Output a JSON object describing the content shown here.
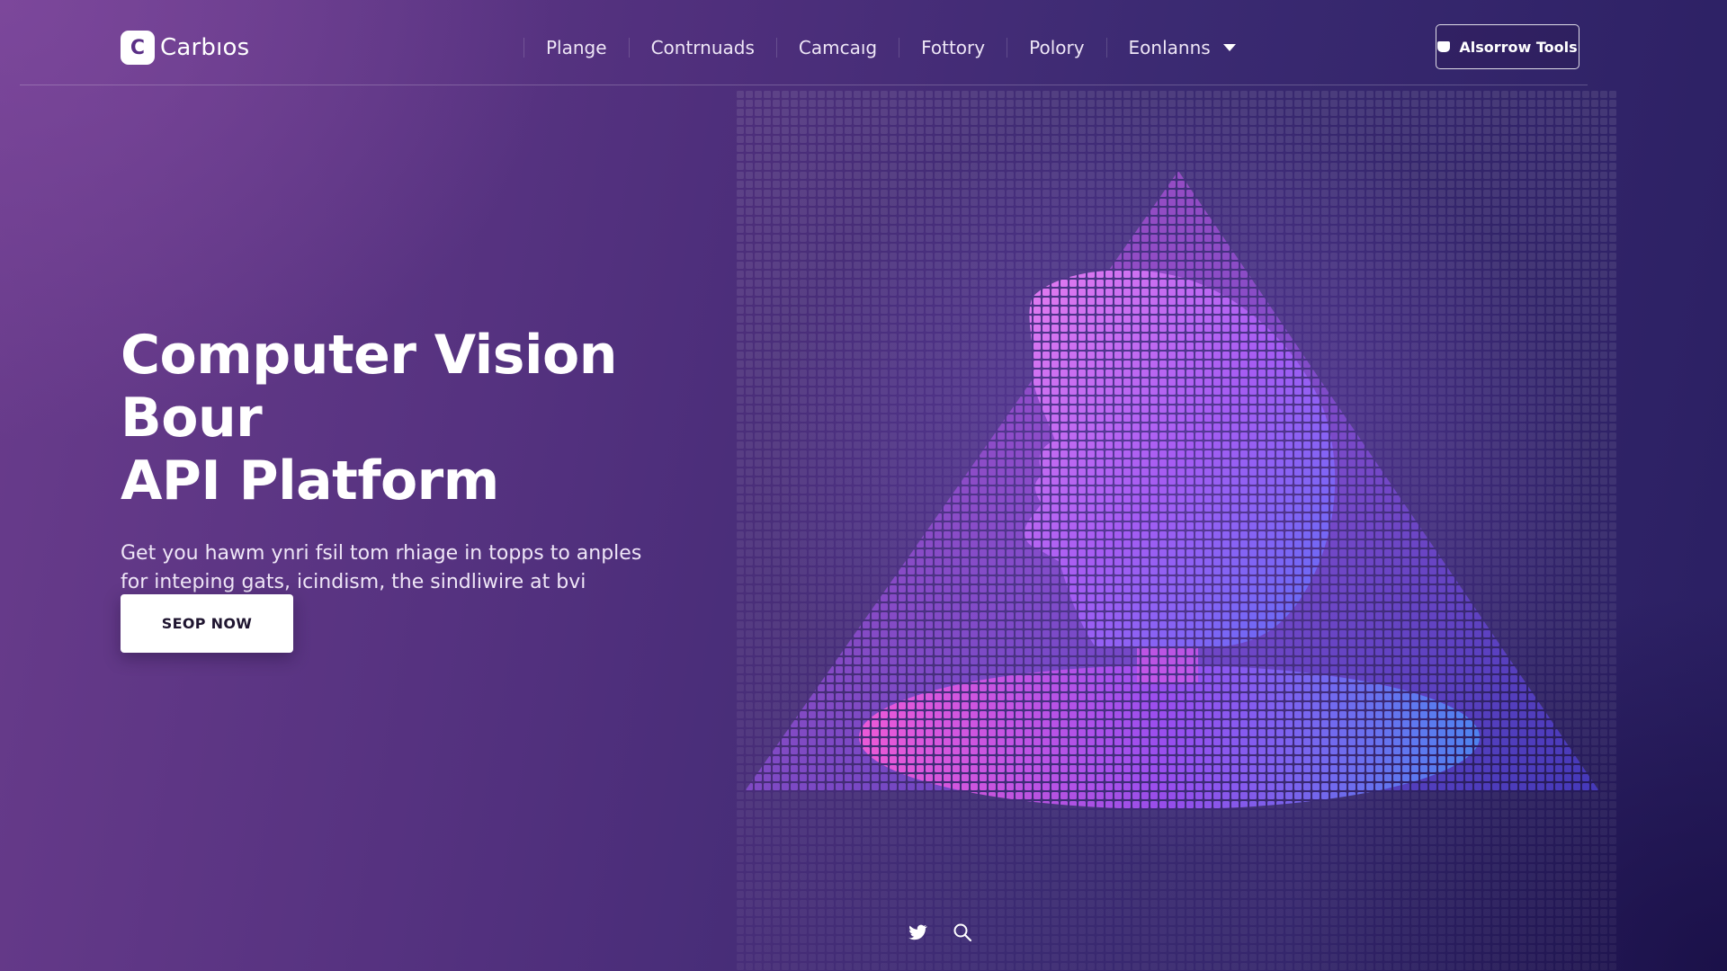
{
  "brand": {
    "name": "Carbıos",
    "logo_mark": "C"
  },
  "nav": {
    "items": [
      {
        "label": "Plange"
      },
      {
        "label": "Contrnuads"
      },
      {
        "label": "Camcaıg"
      },
      {
        "label": "Fottory"
      },
      {
        "label": "Polory"
      },
      {
        "label": "Eonlanns",
        "has_dropdown": true
      }
    ],
    "cta_label": "Alsorrow Tools",
    "cta_icon": "shield-icon"
  },
  "hero": {
    "title_line1": "Computer Vision Bour",
    "title_line2": "API Platform",
    "subtitle": "Get you hawm ynri fsil tom rhiage in topps to anples for inteping gats, icindism, the sindliwire at bvi ainginou mollıig.",
    "button_label": "SEOP NOW"
  },
  "footer": {
    "icons": [
      "twitter-icon",
      "search-icon"
    ]
  },
  "colors": {
    "bg_left": "#6a3c8c",
    "bg_right": "#2a1f62",
    "accent_pink": "#e24bd6",
    "accent_violet": "#9a55f0",
    "accent_blue": "#4a6ff0",
    "button_bg": "#ffffff"
  }
}
